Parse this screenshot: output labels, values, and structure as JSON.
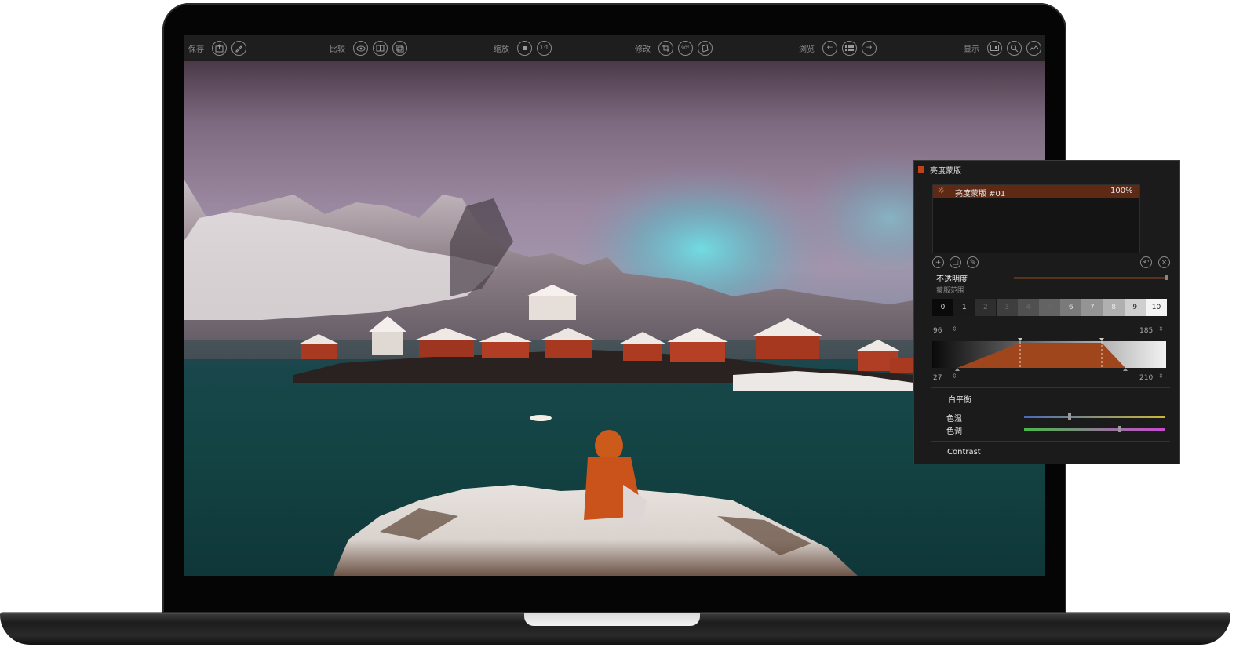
{
  "toolbar": {
    "save": {
      "label": "保存",
      "buttons": [
        "export-icon",
        "edit-export-icon"
      ]
    },
    "compare": {
      "label": "比较",
      "buttons": [
        "eye-icon",
        "split-view-icon",
        "before-after-icon"
      ]
    },
    "zoom": {
      "label": "缩放",
      "buttons": [
        "fit-icon",
        "one-to-one-icon"
      ],
      "one_to_one": "1:1"
    },
    "modify": {
      "label": "修改",
      "buttons": [
        "crop-icon",
        "rotate-icon",
        "straighten-icon"
      ],
      "rotate": "90°"
    },
    "browse": {
      "label": "浏览",
      "buttons": [
        "previous-icon",
        "grid-icon",
        "next-icon"
      ]
    },
    "display": {
      "label": "显示",
      "buttons": [
        "display-mode-icon",
        "loupe-icon",
        "histogram-icon"
      ]
    }
  },
  "mask_panel": {
    "title": "亮度蒙版",
    "layer": {
      "name": "亮度蒙版 #01",
      "opacity": "100%"
    },
    "opacity_label": "不透明度",
    "opacity_value": 1.0,
    "range_label": "蒙版范围",
    "zones": [
      "0",
      "1",
      "2",
      "3",
      "4",
      "5",
      "6",
      "7",
      "8",
      "9",
      "10"
    ],
    "range": {
      "top_left": "96",
      "top_right": "185",
      "bottom_left": "27",
      "bottom_right": "210"
    },
    "white_balance": {
      "label": "白平衡",
      "temperature_label": "色温",
      "tint_label": "色调",
      "temperature_value": 0.32,
      "tint_value": 0.68
    },
    "contrast_label": "Contrast",
    "accent_color": "#c0421a"
  }
}
